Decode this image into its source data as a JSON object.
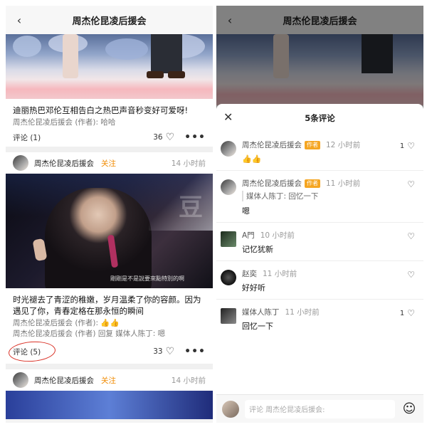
{
  "nav": {
    "title": "周杰伦昆凌后援会",
    "back_icon": "‹"
  },
  "post1": {
    "text": "迪丽热巴邓伦互相告白之热巴声音秒变好可爱呀!",
    "meta": "周杰伦昆凌后援会 (作者): 哈哈",
    "comment_label": "评论 (1)",
    "likes": "36"
  },
  "post2": {
    "author": "周杰伦昆凌后援会",
    "follow": "关注",
    "time": "14 小时前",
    "image_subtitle": "剛剛是不是說要來點特別的啊",
    "watermark": "豆",
    "text": "时光褪去了青涩的稚嫩，岁月温柔了你的容颜。因为遇见了你，青春定格在那永恒的瞬间",
    "meta1": "周杰伦昆凌后援会 (作者): 👍👍",
    "meta2": "周杰伦昆凌后援会 (作者) 回复 媒体人陈丁: 嗯",
    "comment_label": "评论 (5)",
    "likes": "33"
  },
  "post3": {
    "author": "周杰伦昆凌后援会",
    "follow": "关注",
    "time": "14 小时前"
  },
  "sheet": {
    "title": "5条评论",
    "comments": [
      {
        "author": "周杰伦昆凌后援会",
        "tag": "作者",
        "time": "12 小时前",
        "text": "👍👍",
        "quote": "",
        "likes": "1"
      },
      {
        "author": "周杰伦昆凌后援会",
        "tag": "作者",
        "time": "11 小时前",
        "text": "嗯",
        "quote": "媒体人陈丁: 回忆一下",
        "likes": ""
      },
      {
        "author": "A門",
        "tag": "",
        "time": "10 小时前",
        "text": "记忆犹新",
        "quote": "",
        "likes": ""
      },
      {
        "author": "赵奕",
        "tag": "",
        "time": "11 小时前",
        "text": "好好听",
        "quote": "",
        "likes": ""
      },
      {
        "author": "媒体人陈丁",
        "tag": "",
        "time": "11 小时前",
        "text": "回忆一下",
        "quote": "",
        "likes": "1"
      }
    ],
    "input_placeholder": "评论 周杰伦昆凌后援会:"
  },
  "icons": {
    "heart": "heart-outline-icon",
    "more": "more-dots-icon",
    "close": "close-icon",
    "emoji": "emoji-icon"
  }
}
